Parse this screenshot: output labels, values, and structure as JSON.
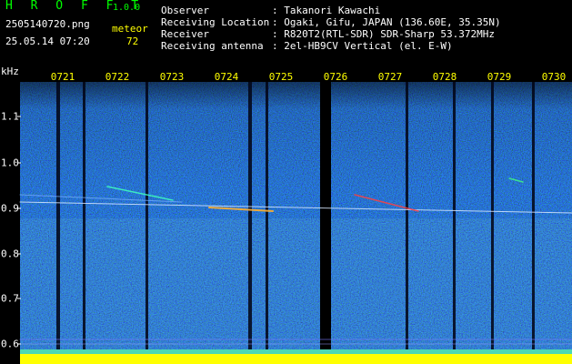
{
  "header": {
    "app_title": "H R O F F T",
    "app_version": "1.0.0",
    "file_name": "2505140720.png",
    "mode_label": "meteor",
    "timestamp": "25.05.14 07:20",
    "meteor_count": "72"
  },
  "info": {
    "keys": "Observer\nReceiving Location\nReceiver\nReceiving antenna",
    "values": ": Takanori Kawachi\n: Ogaki, Gifu, JAPAN (136.60E, 35.35N)\n: R820T2(RTL-SDR) SDR-Sharp 53.372MHz\n: 2el-HB9CV Vertical (el. E-W)"
  },
  "y_axis": {
    "unit": "kHz",
    "ticks": [
      "1.1",
      "1.0",
      "0.9",
      "0.8",
      "0.7",
      "0.6"
    ]
  },
  "x_axis": {
    "ticks": [
      "0721",
      "0722",
      "0723",
      "0724",
      "0725",
      "0726",
      "0727",
      "0728",
      "0729",
      "0730"
    ]
  },
  "colors": {
    "background": "#000000",
    "text_green": "#00ff00",
    "text_yellow": "#ffff00",
    "noise": "#1a2a8a",
    "carrier": "#ffffff",
    "bottom_band": "#ffff00"
  }
}
